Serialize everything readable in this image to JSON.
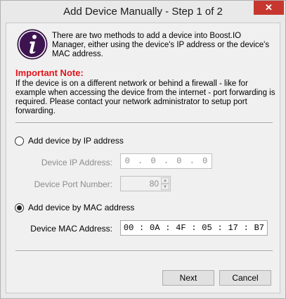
{
  "window": {
    "title": "Add Device Manually - Step 1 of 2",
    "close_glyph": "✕"
  },
  "intro": {
    "icon": "info-icon",
    "text": "There are two methods to add a device into Boost.IO Manager, either using the device's IP address or the device's MAC address."
  },
  "note": {
    "heading": "Important Note:",
    "body": "If the device is on a different network or behind a firewall - like for example when accessing the device from the internet - port forwarding is required. Please contact your network administrator to setup port forwarding."
  },
  "ip_option": {
    "label": "Add device by IP address",
    "selected": false,
    "ip_label": "Device IP Address:",
    "ip_octets": [
      "0",
      "0",
      "0",
      "0"
    ],
    "ip_separator": ".",
    "port_label": "Device Port Number:",
    "port_value": "80",
    "enabled": false
  },
  "mac_option": {
    "label": "Add device by MAC address",
    "selected": true,
    "mac_label": "Device MAC Address:",
    "mac_bytes": [
      "00",
      "0A",
      "4F",
      "05",
      "17",
      "B7"
    ],
    "mac_separator": ":"
  },
  "buttons": {
    "next": "Next",
    "cancel": "Cancel"
  },
  "colors": {
    "note_heading": "#e4141b",
    "icon_bg": "#3d1450",
    "close_bg": "#c7372f"
  }
}
